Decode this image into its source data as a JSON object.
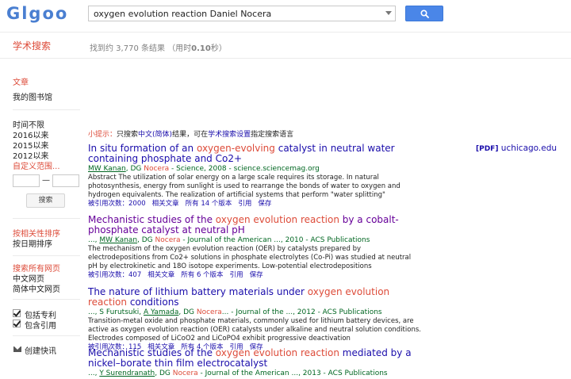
{
  "header": {
    "logo_text": "Glgoo",
    "search_value": "oxygen evolution reaction Daniel Nocera",
    "search_button_icon": "magnifier-icon",
    "accent_color": "#4a86e8"
  },
  "subheader": {
    "section_title": "学术搜索",
    "stats_prefix": "找到约 3,770 条结果 （用时",
    "stats_time": "0.10",
    "stats_suffix": "秒）"
  },
  "sidebar": {
    "articles": "文章",
    "my_library": "我的图书馆",
    "any_time": "时间不限",
    "since_2016": "2016以来",
    "since_2015": "2015以来",
    "since_2012": "2012以来",
    "custom_range": "自定义范围...",
    "dash": "—",
    "search_button": "搜索",
    "sort_relevance": "按相关性排序",
    "sort_date": "按日期排序",
    "all_pages": "搜索所有网页",
    "chinese_pages": "中文网页",
    "simplified_pages": "简体中文网页",
    "include_patents": "包括专利",
    "include_citations": "包含引用",
    "create_alert": "创建快讯"
  },
  "tip": {
    "label": "小提示：",
    "text1": "只搜索",
    "link1": "中文(简体)",
    "text2": "结果，可在",
    "link2": "学术搜索设置",
    "text3": "指定搜索语言"
  },
  "side_link": {
    "tag": "[PDF]",
    "domain": "uchicago.edu"
  },
  "results": [
    {
      "title_pre": "In situ formation of an ",
      "title_hl": "oxygen-evolving",
      "title_post": " catalyst in neutral water containing phosphate and Co2+",
      "auth_a": "MW Kanan",
      "auth_b": ", DG ",
      "auth_hl": "Nocera",
      "auth_c": " - Science, 2008 - science.sciencemag.org",
      "abstract": "Abstract The utilization of solar energy on a large scale requires its storage. In natural photosynthesis, energy from sunlight is used to rearrange the bonds of water to oxygen and hydrogen equivalents. The realization of artificial systems that perform \"water splitting\"",
      "cited": "被引用次数：2000",
      "related": "相关文章",
      "versions": "所有 14 个版本",
      "cite": "引用",
      "save": "保存"
    },
    {
      "title_pre": "Mechanistic studies of the ",
      "title_hl": "oxygen evolution reaction",
      "title_post": " by a cobalt-phosphate catalyst at neutral pH",
      "auth_pre": "..., ",
      "auth_a": "MW Kanan",
      "auth_b": ", DG ",
      "auth_hl": "Nocera",
      "auth_c": " - Journal of the American ..., 2010 - ACS Publications",
      "abstract": "The mechanism of the oxygen evolution reaction (OER) by catalysts prepared by electrodepositions from Co2+ solutions in phosphate electrolytes (Co-Pi) was studied at neutral pH by electrokinetic and 18O isotope experiments. Low-potential electrodepositions",
      "cited": "被引用次数：407",
      "related": "相关文章",
      "versions": "所有 6 个版本",
      "cite": "引用",
      "save": "保存"
    },
    {
      "title_pre": "The nature of lithium battery materials under ",
      "title_hl": "oxygen evolution reaction",
      "title_post": " conditions",
      "auth_pre": "..., S Furutsuki, ",
      "auth_a": "A Yamada",
      "auth_b": ", DG ",
      "auth_hl": "Nocera",
      "auth_c": "... - Journal of the ..., 2012 - ACS Publications",
      "abstract": "Transition-metal oxide and phosphate materials, commonly used for lithium battery devices, are active as oxygen evolution reaction (OER) catalysts under alkaline and neutral solution conditions. Electrodes composed of LiCoO2 and LiCoPO4 exhibit progressive deactivation",
      "cited": "被引用次数：115",
      "related": "相关文章",
      "versions": "所有 4 个版本",
      "cite": "引用",
      "save": "保存"
    },
    {
      "title_pre": "Mechanistic studies of the ",
      "title_hl": "oxygen evolution reaction",
      "title_post": " mediated by a nickel–borate thin film electrocatalyst",
      "auth_pre": "..., ",
      "auth_a": "Y Surendranath",
      "auth_b": ", DG ",
      "auth_hl": "Nocera",
      "auth_c": " - Journal of the American ..., 2013 - ACS Publications"
    }
  ]
}
